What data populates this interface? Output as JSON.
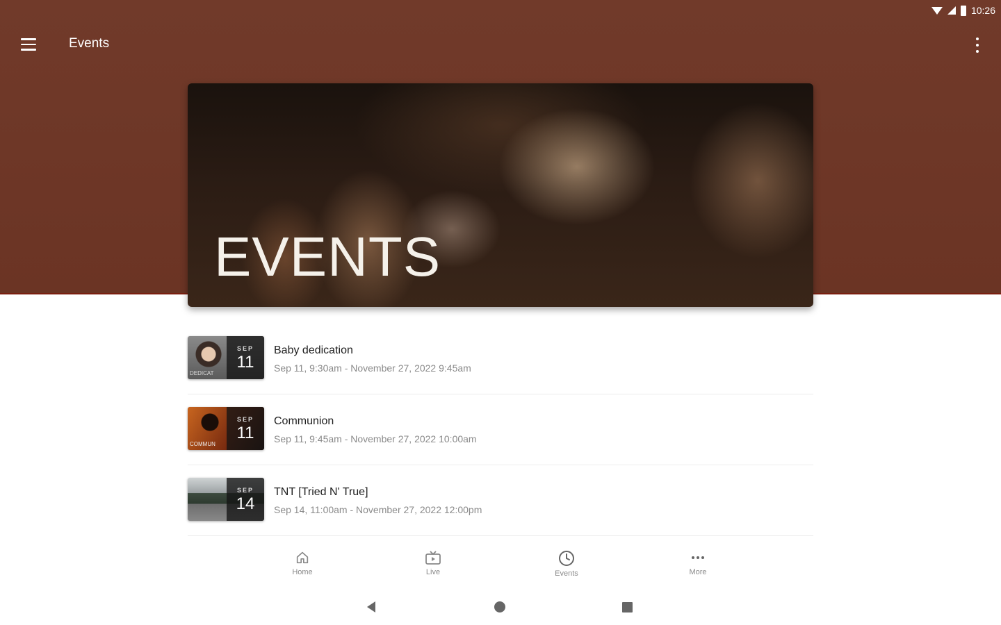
{
  "status_bar": {
    "time": "10:26"
  },
  "app_bar": {
    "title": "Events"
  },
  "hero": {
    "title": "EVENTS"
  },
  "events": [
    {
      "title": "Baby dedication",
      "time": "Sep 11, 9:30am - November 27, 2022 9:45am",
      "month": "SEP",
      "day": "11",
      "thumb_text": "DEDICAT"
    },
    {
      "title": "Communion",
      "time": "Sep 11, 9:45am - November 27, 2022 10:00am",
      "month": "SEP",
      "day": "11",
      "thumb_text": "COMMUN"
    },
    {
      "title": "TNT [Tried N' True]",
      "time": "Sep 14, 11:00am - November 27, 2022 12:00pm",
      "month": "SEP",
      "day": "14",
      "thumb_text": ""
    }
  ],
  "bottom_nav": {
    "home": "Home",
    "live": "Live",
    "events": "Events",
    "more": "More"
  },
  "colors": {
    "header_bg": "#713a2a",
    "accent_line": "#7a1f10",
    "nav_icon": "#888888"
  }
}
